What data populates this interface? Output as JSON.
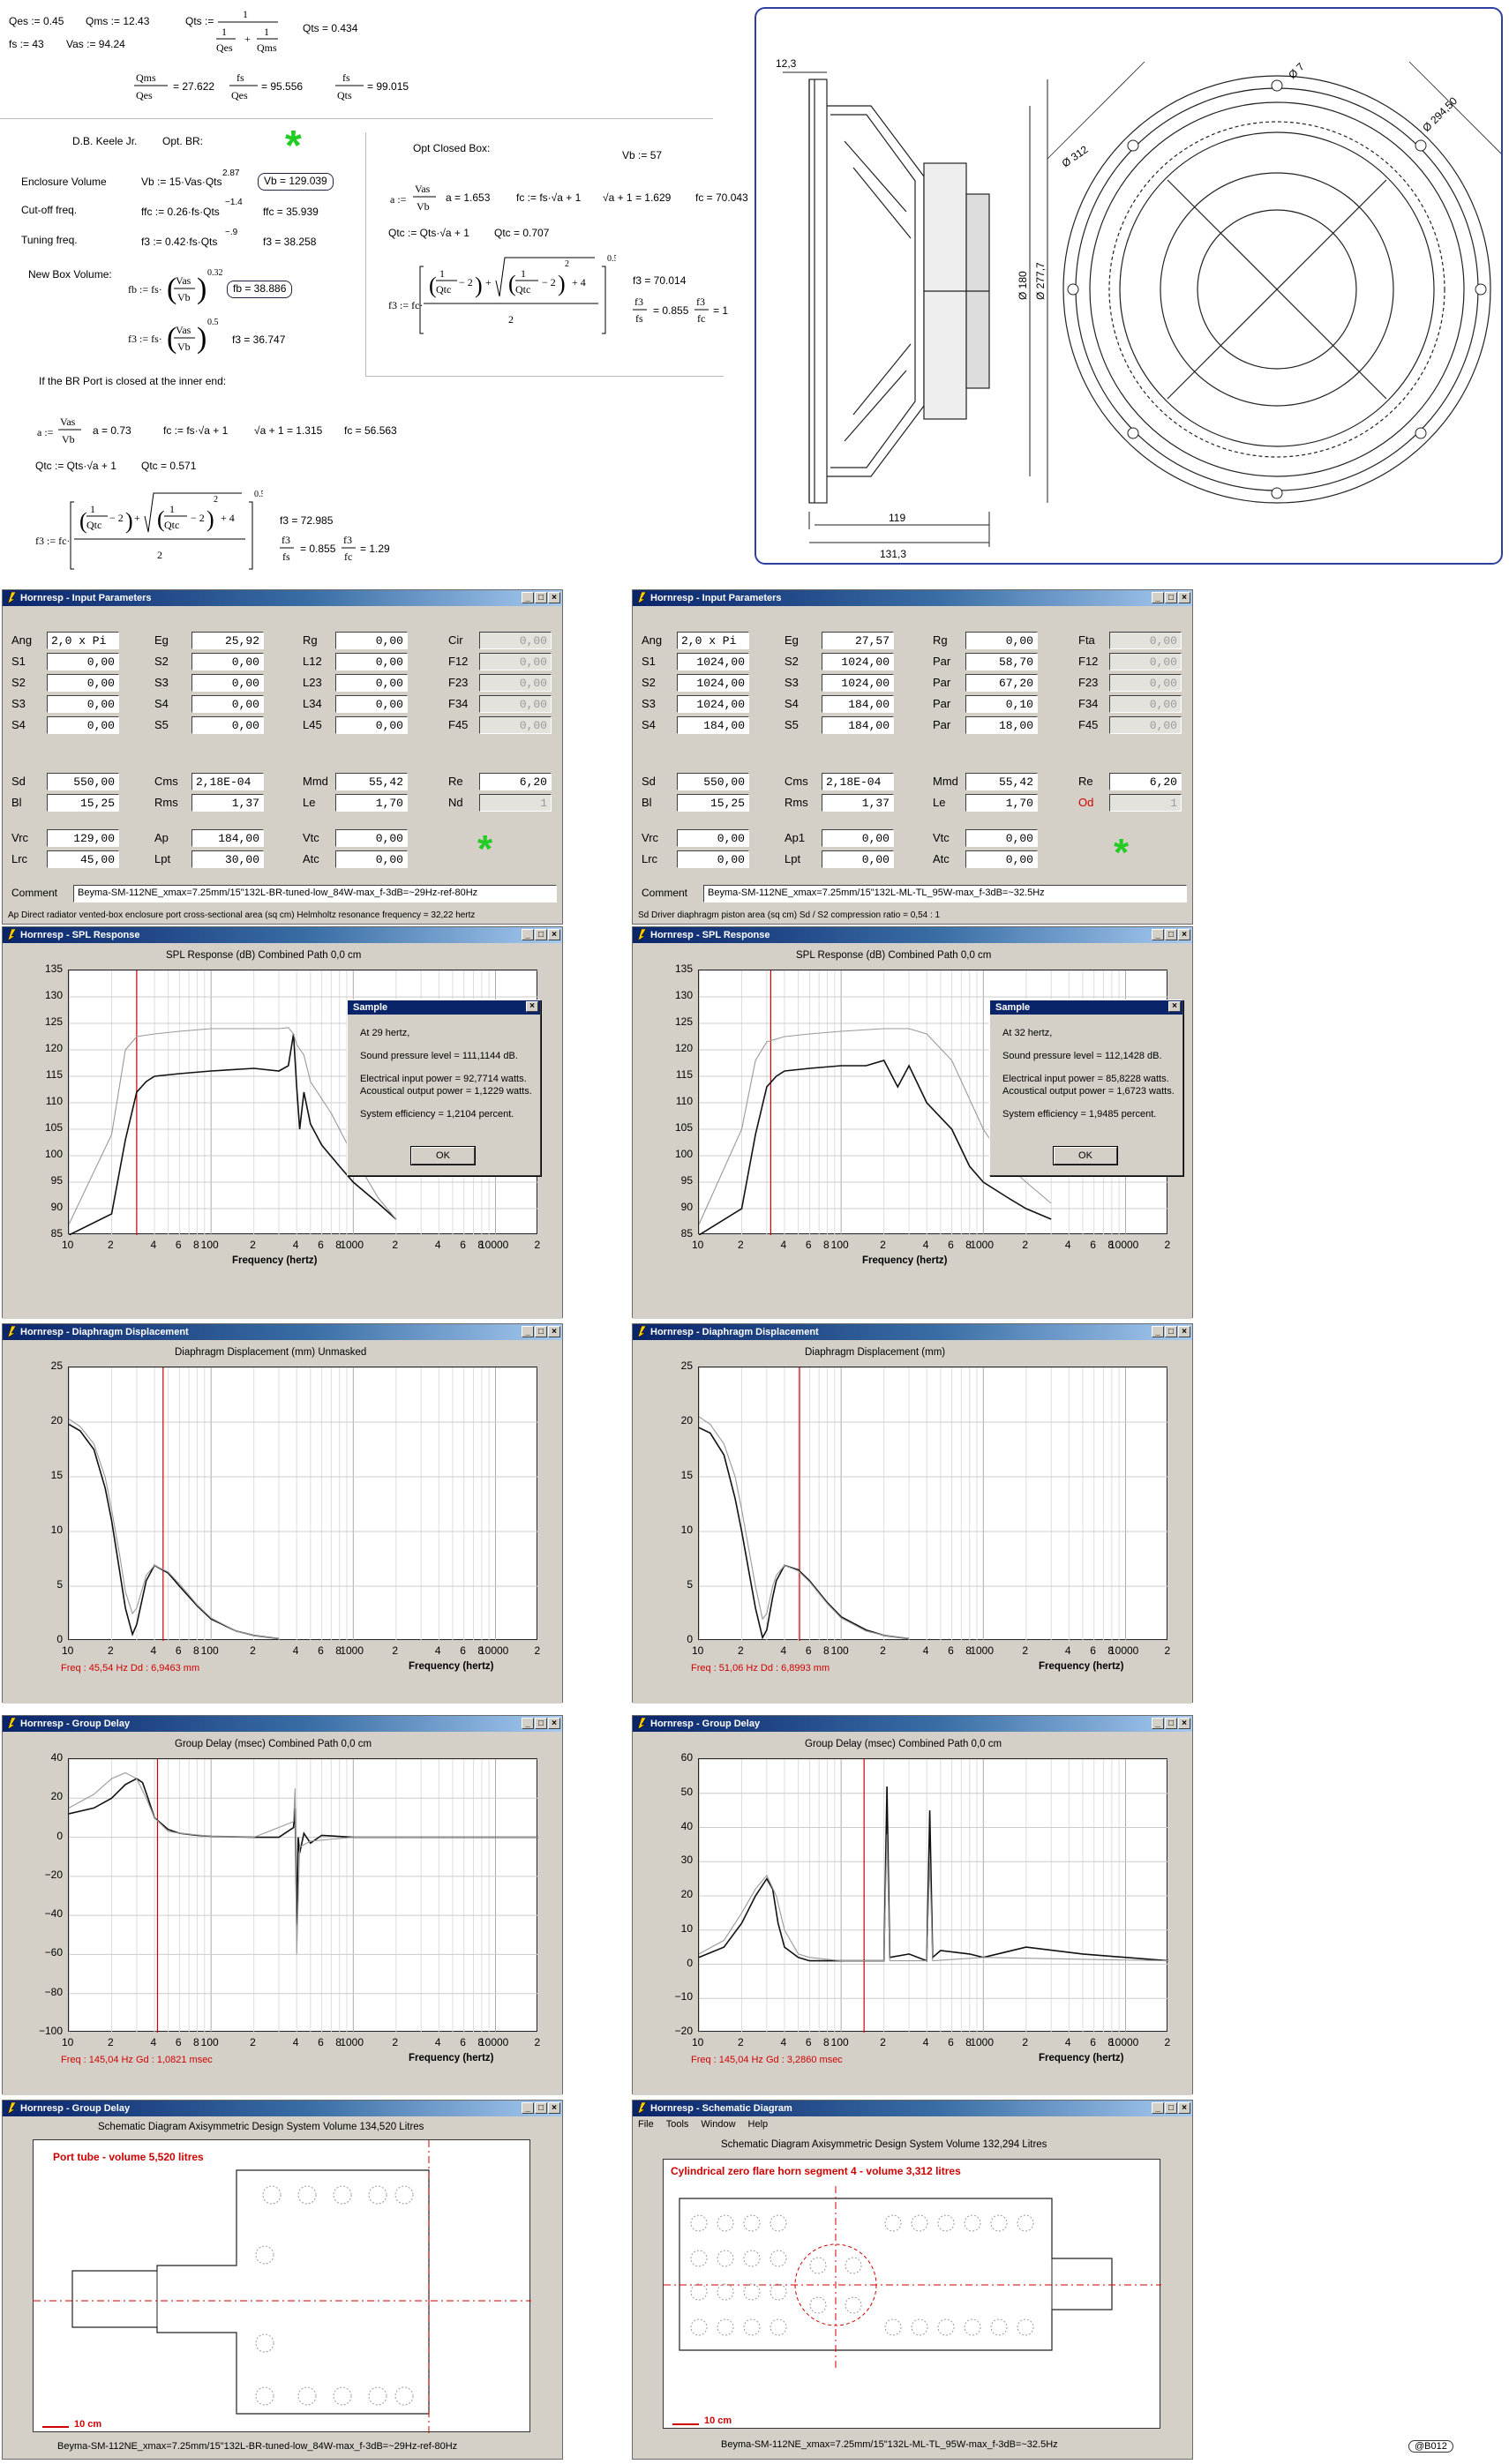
{
  "math": {
    "qes": "Qes := 0.45",
    "qms": "Qms := 12.43",
    "qts_def": "Qts :=",
    "qts_val": "Qts = 0.434",
    "fs": "fs := 43",
    "vas": "Vas := 94.24",
    "r1": "= 27.622",
    "r2": "= 95.556",
    "r3": "= 99.015",
    "keele": "D.B. Keele Jr.",
    "optbr": "Opt. BR:",
    "optclosed": "Opt Closed Box:",
    "vb57": "Vb := 57",
    "enc_vol": "Enclosure Volume",
    "enc_formula": "Vb := 15·Vas·Qts",
    "enc_exp": "2.87",
    "enc_val": "Vb = 129.039",
    "cutoff": "Cut-off freq.",
    "cutoff_formula": "ffc := 0.26·fs·Qts",
    "cutoff_exp": "−1.4",
    "cutoff_val": "ffc = 35.939",
    "tuning": "Tuning freq.",
    "tuning_formula": "f3 := 0.42·fs·Qts",
    "tuning_exp": "−.9",
    "tuning_val": "f3 = 38.258",
    "newbox": "New Box Volume:",
    "fb_val": "fb = 38.886",
    "f3_val": "f3 = 36.747",
    "a1": "a = 1.653",
    "fc1": "fc := fs·√a + 1",
    "sq1": "√a + 1 = 1.629",
    "fc1_val": "fc = 70.043",
    "qtc1": "Qtc := Qts·√a + 1",
    "qtc1_val": "Qtc = 0.707",
    "f3b": "f3 = 70.014",
    "f3fs_b": "= 0.855",
    "f3fc_b": "= 1",
    "port_closed": "If the BR Port is closed at the inner end:",
    "a2": "a = 0.73",
    "fc2": "fc := fs·√a + 1",
    "sq2": "√a + 1 = 1.315",
    "fc2_val": "fc = 56.563",
    "qtc2": "Qtc := Qts·√a + 1",
    "qtc2_val": "Qtc = 0.571",
    "f3c": "f3 = 72.985",
    "f3fs_c": "= 0.855",
    "f3fc_c": "= 1.29"
  },
  "drawing": {
    "dim_12_3": "12,3",
    "dim_119": "119",
    "dim_131": "131,3",
    "dim_180": "Ø 180",
    "dim_277": "Ø 277,7",
    "dim_312": "Ø 312",
    "dim_2945": "Ø 294,50",
    "dim_7": "Ø 7"
  },
  "windows": {
    "params_title": "Hornresp - Input Parameters",
    "spl_title": "Hornresp - SPL Response",
    "disp_title": "Hornresp - Diaphragm Displacement",
    "gd_title": "Hornresp - Group Delay",
    "schem_title": "Hornresp - Schematic Diagram",
    "gd_title_left_bottom": "Hornresp - Group Delay"
  },
  "left_params": {
    "row1": {
      "Ang": "2,0 x Pi",
      "Eg": "25,92",
      "Rg": "0,00",
      "Cir": "0,00"
    },
    "rowS1": [
      "0,00",
      "0,00",
      "0,00",
      "0,00"
    ],
    "rowS2": [
      "0,00",
      "0,00",
      "0,00",
      "0,00"
    ],
    "rowS3": [
      "0,00",
      "0,00",
      "0,00",
      "0,00"
    ],
    "rowS4": [
      "0,00",
      "0,00",
      "0,00",
      "0,00"
    ],
    "sd": "550,00",
    "bl": "15,25",
    "cms": "2,18E-04",
    "rms": "1,37",
    "mmd": "55,42",
    "le": "1,70",
    "re": "6,20",
    "nd": "1",
    "vrc": "129,00",
    "lrc": "45,00",
    "ap": "184,00",
    "lpt": "30,00",
    "vtc": "0,00",
    "atc": "0,00",
    "comment": "Beyma-SM-112NE_xmax=7.25mm/15\"132L-BR-tuned-low_84W-max_f-3dB=~29Hz-ref-80Hz",
    "status": "Ap  Direct radiator vented-box enclosure port cross-sectional area  (sq cm)   Helmholtz resonance frequency = 32,22 hertz"
  },
  "right_params": {
    "row1": {
      "Ang": "2,0 x Pi",
      "Eg": "27,57",
      "Rg": "0,00",
      "Fta": "0,00"
    },
    "rowS1": [
      "1024,00",
      "1024,00",
      "58,70",
      "0,00"
    ],
    "rowS2": [
      "1024,00",
      "1024,00",
      "67,20",
      "0,00"
    ],
    "rowS3": [
      "1024,00",
      "184,00",
      "0,10",
      "0,00"
    ],
    "rowS4": [
      "184,00",
      "184,00",
      "18,00",
      "0,00"
    ],
    "sd": "550,00",
    "bl": "15,25",
    "cms": "2,18E-04",
    "rms": "1,37",
    "mmd": "55,42",
    "le": "1,70",
    "re": "6,20",
    "od": "1",
    "vrc": "0,00",
    "lrc": "0,00",
    "ap1": "0,00",
    "lpt": "0,00",
    "vtc": "0,00",
    "atc": "0,00",
    "comment": "Beyma-SM-112NE_xmax=7.25mm/15\"132L-ML-TL_95W-max_f-3dB=~32.5Hz",
    "status": "Sd   Driver diaphragm piston area  (sq cm)   Sd / S2 compression ratio = 0,54 : 1"
  },
  "labels": {
    "Ang": "Ang",
    "Eg": "Eg",
    "Rg": "Rg",
    "Cir": "Cir",
    "Fta": "Fta",
    "S1": "S1",
    "S2": "S2",
    "S3": "S3",
    "S4": "S4",
    "S5": "S5",
    "L12": "L12",
    "L23": "L23",
    "L34": "L34",
    "L45": "L45",
    "F12": "F12",
    "F23": "F23",
    "F34": "F34",
    "F45": "F45",
    "Par": "Par",
    "Sd": "Sd",
    "Bl": "Bl",
    "Cms": "Cms",
    "Rms": "Rms",
    "Mmd": "Mmd",
    "Le": "Le",
    "Re": "Re",
    "Nd": "Nd",
    "Od": "Od",
    "Vrc": "Vrc",
    "Lrc": "Lrc",
    "Ap": "Ap",
    "Ap1": "Ap1",
    "Lpt": "Lpt",
    "Vtc": "Vtc",
    "Atc": "Atc",
    "Comment": "Comment"
  },
  "spl": {
    "title_left": "SPL Response (dB)    Combined    Path 0,0 cm",
    "title_right": "SPL Response (dB)    Combined    Path 0,0 cm",
    "xlabel": "Frequency (hertz)",
    "dlg_title": "Sample",
    "left_dlg": [
      "At 29 hertz,",
      "Sound pressure level = 111,1144 dB.",
      "Electrical input power = 92,7714 watts.",
      "Acoustical output power = 1,1229 watts.",
      "System efficiency = 1,2104 percent."
    ],
    "right_dlg": [
      "At 32 hertz,",
      "Sound pressure level = 112,1428 dB.",
      "Electrical input power = 85,8228 watts.",
      "Acoustical output power = 1,6723 watts.",
      "System efficiency = 1,9485 percent."
    ],
    "ok": "OK"
  },
  "disp": {
    "title_left": "Diaphragm Displacement (mm)    Unmasked",
    "title_right": "Diaphragm Displacement (mm)",
    "left_readout": "Freq : 45,54 Hz     Dd : 6,9463 mm",
    "right_readout": "Freq : 51,06 Hz     Dd : 6,8993 mm"
  },
  "gd": {
    "title": "Group Delay (msec)    Combined    Path 0,0 cm",
    "left_readout": "Freq : 145,04 Hz     Gd : 1,0821 msec",
    "right_readout": "Freq : 145,04 Hz     Gd : 3,2860 msec"
  },
  "schematic": {
    "left_title": "Schematic Diagram    Axisymmetric Design    System Volume 134,520 Litres",
    "right_title": "Schematic Diagram    Axisymmetric Design    System Volume 132,294 Litres",
    "left_seg": "Port tube - volume 5,520 litres",
    "right_seg": "Cylindrical zero flare horn segment 4 - volume 3,312 litres",
    "scale": "10 cm",
    "left_footer": "Beyma-SM-112NE_xmax=7.25mm/15\"132L-BR-tuned-low_84W-max_f-3dB=~29Hz-ref-80Hz",
    "right_footer": "Beyma-SM-112NE_xmax=7.25mm/15\"132L-ML-TL_95W-max_f-3dB=~32.5Hz",
    "menu": [
      "File",
      "Tools",
      "Window",
      "Help"
    ]
  },
  "copyright": "@B012",
  "colors": {
    "accent": "#0a246a",
    "red": "#d00000",
    "green": "#22cc22"
  },
  "chart_data": [
    {
      "type": "line",
      "title": "SPL Response (dB)    Combined    Path 0,0 cm",
      "xlabel": "Frequency (hertz)",
      "xscale": "log",
      "xlim": [
        10,
        20000
      ],
      "ylim": [
        85,
        135
      ],
      "yticks": [
        135,
        130,
        125,
        120,
        115,
        110,
        105,
        100,
        95,
        90,
        85
      ],
      "xticks": [
        "10",
        "2",
        "4",
        "6",
        "8",
        "100",
        "2",
        "4",
        "6",
        "8",
        "1000",
        "2",
        "4",
        "6",
        "8",
        "10000",
        "2"
      ],
      "series": [
        {
          "x": [
            10,
            20,
            25,
            30,
            35,
            40,
            60,
            100,
            200,
            300,
            350,
            380,
            400,
            420,
            450,
            500,
            600,
            800,
            1000,
            1500,
            2000
          ],
          "y": [
            85,
            89,
            103,
            112,
            114,
            115,
            115.5,
            116,
            116.5,
            116,
            117,
            123,
            113,
            105,
            112,
            106,
            102,
            98,
            95,
            91,
            88
          ]
        },
        {
          "x": [
            10,
            20,
            25,
            30,
            40,
            60,
            100,
            200,
            300,
            350,
            380,
            400,
            450,
            500,
            700,
            1000,
            1500,
            2000
          ],
          "y": [
            87,
            104,
            120,
            122.5,
            123,
            123.5,
            124,
            124,
            124,
            124.2,
            123,
            121,
            119,
            114,
            108,
            100,
            92,
            88
          ]
        }
      ]
    },
    {
      "type": "line",
      "title": "SPL Response (dB)    Combined    Path 0,0 cm",
      "xlabel": "Frequency (hertz)",
      "xscale": "log",
      "xlim": [
        10,
        20000
      ],
      "ylim": [
        85,
        135
      ],
      "yticks": [
        135,
        130,
        125,
        120,
        115,
        110,
        105,
        100,
        95,
        90,
        85
      ],
      "xticks": [
        "10",
        "2",
        "4",
        "6",
        "8",
        "100",
        "2",
        "4",
        "6",
        "8",
        "1000",
        "2",
        "4",
        "6",
        "8",
        "10000",
        "2"
      ],
      "series": [
        {
          "x": [
            10,
            20,
            25,
            30,
            35,
            40,
            60,
            100,
            150,
            200,
            250,
            300,
            400,
            600,
            800,
            1000,
            1500,
            2000,
            3000
          ],
          "y": [
            85,
            90,
            104,
            113,
            115,
            116,
            116.5,
            117,
            117,
            118,
            113,
            117,
            110,
            105,
            98,
            95,
            92,
            90,
            88
          ]
        },
        {
          "x": [
            10,
            20,
            25,
            30,
            40,
            60,
            100,
            200,
            300,
            400,
            600,
            1000,
            1500,
            2000,
            3000
          ],
          "y": [
            87,
            105,
            118,
            121.5,
            122.5,
            123,
            123.5,
            124,
            124,
            123,
            118,
            105,
            98,
            95,
            91
          ]
        }
      ]
    },
    {
      "type": "line",
      "title": "Diaphragm Displacement (mm)    Unmasked",
      "xlabel": "Frequency (hertz)",
      "xscale": "log",
      "xlim": [
        10,
        20000
      ],
      "ylim": [
        0,
        25
      ],
      "yticks": [
        25,
        20,
        15,
        10,
        5,
        0
      ],
      "xticks": [
        "10",
        "2",
        "4",
        "6",
        "8",
        "100",
        "2",
        "4",
        "6",
        "8",
        "1000",
        "2",
        "4",
        "6",
        "8",
        "10000",
        "2"
      ],
      "series": [
        {
          "x": [
            10,
            12,
            15,
            18,
            20,
            23,
            25,
            28,
            30,
            35,
            40,
            50,
            60,
            80,
            100,
            150,
            200,
            300
          ],
          "y": [
            19.8,
            19.2,
            17.5,
            14,
            11,
            6,
            3,
            0.6,
            1.5,
            5.5,
            6.9,
            6.2,
            5,
            3.2,
            2,
            0.9,
            0.5,
            0.2
          ]
        },
        {
          "x": [
            10,
            12,
            15,
            18,
            20,
            23,
            25,
            28,
            30,
            35,
            40,
            50,
            60,
            80,
            100,
            150,
            200,
            300
          ],
          "y": [
            20.3,
            19.6,
            18,
            15,
            12,
            7.5,
            4.5,
            2.5,
            3,
            6,
            6.9,
            6.3,
            5.2,
            3.3,
            2.1,
            0.9,
            0.5,
            0.2
          ]
        }
      ]
    },
    {
      "type": "line",
      "title": "Diaphragm Displacement (mm)",
      "xlabel": "Frequency (hertz)",
      "xscale": "log",
      "xlim": [
        10,
        20000
      ],
      "ylim": [
        0,
        25
      ],
      "yticks": [
        25,
        20,
        15,
        10,
        5,
        0
      ],
      "xticks": [
        "10",
        "2",
        "4",
        "6",
        "8",
        "100",
        "2",
        "4",
        "6",
        "8",
        "1000",
        "2",
        "4",
        "6",
        "8",
        "10000",
        "2"
      ],
      "series": [
        {
          "x": [
            10,
            12,
            15,
            18,
            20,
            25,
            28,
            30,
            33,
            35,
            40,
            50,
            60,
            80,
            100,
            150,
            200,
            300
          ],
          "y": [
            19.5,
            19,
            17,
            13,
            10,
            3,
            0.3,
            1,
            4,
            5.5,
            6.9,
            6.5,
            5.5,
            3.5,
            2.2,
            1,
            0.5,
            0.2
          ]
        },
        {
          "x": [
            10,
            12,
            15,
            18,
            20,
            25,
            28,
            30,
            33,
            35,
            40,
            50,
            60,
            80,
            100,
            150,
            200,
            300
          ],
          "y": [
            20.5,
            19.8,
            18,
            15,
            12,
            5,
            2,
            2.5,
            5,
            6,
            6.9,
            6.4,
            5.4,
            3.4,
            2.1,
            0.9,
            0.5,
            0.2
          ]
        }
      ]
    },
    {
      "type": "line",
      "title": "Group Delay (msec)    Combined    Path 0,0 cm",
      "xlabel": "Frequency (hertz)",
      "xscale": "log",
      "xlim": [
        10,
        20000
      ],
      "ylim": [
        -100,
        40
      ],
      "yticks": [
        40,
        20,
        0,
        -20,
        -40,
        -60,
        -80,
        -100
      ],
      "xticks": [
        "10",
        "2",
        "4",
        "6",
        "8",
        "100",
        "2",
        "4",
        "6",
        "8",
        "1000",
        "2",
        "4",
        "6",
        "8",
        "10000",
        "2"
      ],
      "series": [
        {
          "x": [
            10,
            15,
            20,
            25,
            30,
            33,
            36,
            40,
            50,
            60,
            80,
            100,
            200,
            300,
            380,
            390,
            400,
            410,
            420,
            450,
            500,
            600,
            1000,
            2000,
            20000
          ],
          "y": [
            12,
            15,
            20,
            27,
            30,
            28,
            20,
            10,
            4,
            2,
            1,
            0.5,
            0,
            0,
            5,
            15,
            -45,
            0,
            -8,
            2,
            -3,
            1,
            0,
            0,
            0
          ]
        },
        {
          "x": [
            10,
            15,
            20,
            25,
            30,
            35,
            40,
            50,
            60,
            100,
            200,
            380,
            390,
            400,
            420,
            500,
            1000,
            20000
          ],
          "y": [
            15,
            22,
            30,
            33,
            30,
            20,
            10,
            3,
            2,
            0.5,
            0,
            8,
            25,
            -60,
            -5,
            -2,
            0,
            0
          ]
        }
      ]
    },
    {
      "type": "line",
      "title": "Group Delay (msec)    Combined    Path 0,0 cm",
      "xlabel": "Frequency (hertz)",
      "xscale": "log",
      "xlim": [
        10,
        20000
      ],
      "ylim": [
        -20,
        60
      ],
      "yticks": [
        60,
        50,
        40,
        30,
        20,
        10,
        0,
        -10,
        -20
      ],
      "xticks": [
        "10",
        "2",
        "4",
        "6",
        "8",
        "100",
        "2",
        "4",
        "6",
        "8",
        "1000",
        "2",
        "4",
        "6",
        "8",
        "10000",
        "2"
      ],
      "series": [
        {
          "x": [
            10,
            15,
            20,
            25,
            30,
            33,
            36,
            40,
            50,
            60,
            100,
            150,
            200,
            210,
            220,
            300,
            400,
            420,
            440,
            500,
            800,
            1000,
            2000,
            5000,
            20000
          ],
          "y": [
            2,
            5,
            12,
            20,
            25,
            22,
            12,
            5,
            2,
            1,
            1,
            1,
            1,
            52,
            2,
            3,
            1,
            45,
            2,
            4,
            3,
            2,
            5,
            3,
            1
          ]
        },
        {
          "x": [
            10,
            15,
            20,
            25,
            30,
            35,
            40,
            50,
            60,
            100,
            200,
            210,
            220,
            400,
            420,
            440,
            1000,
            20000
          ],
          "y": [
            3,
            7,
            15,
            22,
            26,
            20,
            10,
            3,
            2,
            1,
            1,
            38,
            1,
            1,
            30,
            1,
            2,
            1
          ]
        }
      ]
    }
  ]
}
